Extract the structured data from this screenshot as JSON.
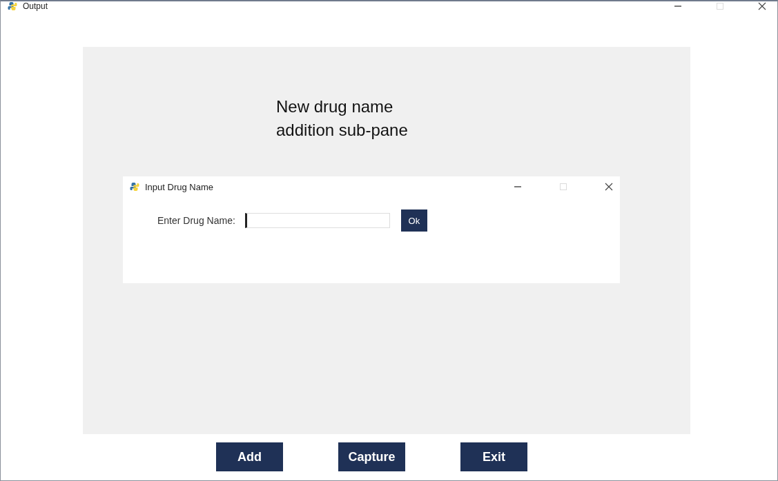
{
  "window": {
    "title": "Output"
  },
  "annotation": {
    "lines": [
      "New drug name",
      "addition sub-pane"
    ]
  },
  "dialog": {
    "title": "Input Drug Name",
    "label": "Enter Drug Name:",
    "button": "Ok"
  },
  "buttons": [
    {
      "label": "Add"
    },
    {
      "label": "Capture"
    },
    {
      "label": "Exit"
    }
  ]
}
